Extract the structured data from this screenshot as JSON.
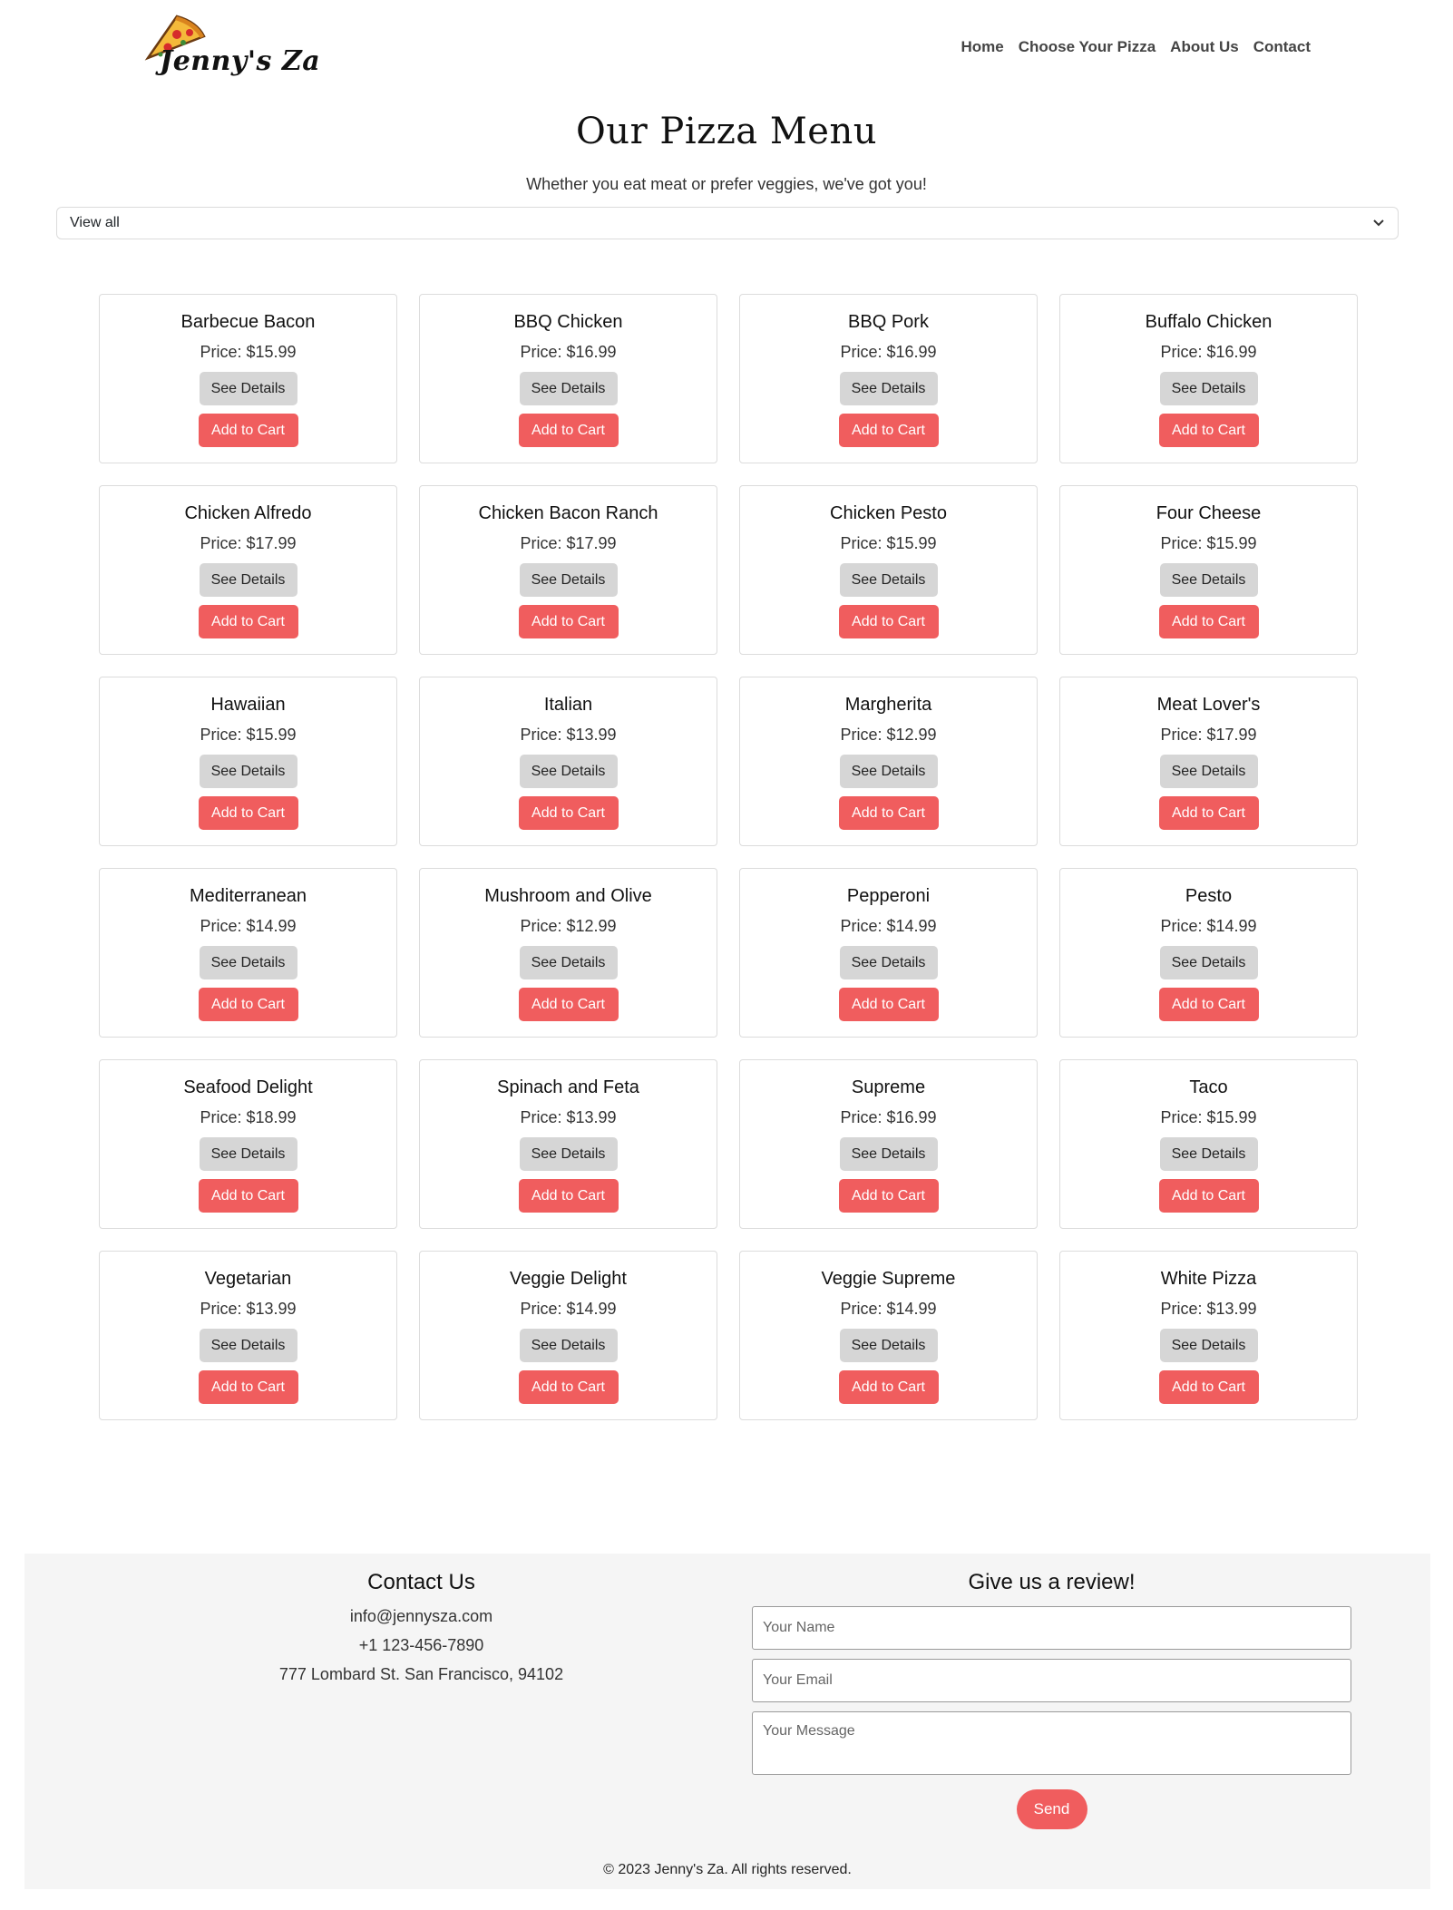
{
  "brand": {
    "name": "Jenny's Za"
  },
  "nav": {
    "items": [
      "Home",
      "Choose Your Pizza",
      "About Us",
      "Contact"
    ]
  },
  "page": {
    "title": "Our Pizza Menu",
    "subtitle": "Whether you eat meat or prefer veggies, we've got you!",
    "filter_value": "View all"
  },
  "buttons": {
    "details": "See Details",
    "cart": "Add to Cart"
  },
  "pizzas": [
    {
      "name": "Barbecue Bacon",
      "price": "Price: $15.99"
    },
    {
      "name": "BBQ Chicken",
      "price": "Price: $16.99"
    },
    {
      "name": "BBQ Pork",
      "price": "Price: $16.99"
    },
    {
      "name": "Buffalo Chicken",
      "price": "Price: $16.99"
    },
    {
      "name": "Chicken Alfredo",
      "price": "Price: $17.99"
    },
    {
      "name": "Chicken Bacon Ranch",
      "price": "Price: $17.99"
    },
    {
      "name": "Chicken Pesto",
      "price": "Price: $15.99"
    },
    {
      "name": "Four Cheese",
      "price": "Price: $15.99"
    },
    {
      "name": "Hawaiian",
      "price": "Price: $15.99"
    },
    {
      "name": "Italian",
      "price": "Price: $13.99"
    },
    {
      "name": "Margherita",
      "price": "Price: $12.99"
    },
    {
      "name": "Meat Lover's",
      "price": "Price: $17.99"
    },
    {
      "name": "Mediterranean",
      "price": "Price: $14.99"
    },
    {
      "name": "Mushroom and Olive",
      "price": "Price: $12.99"
    },
    {
      "name": "Pepperoni",
      "price": "Price: $14.99"
    },
    {
      "name": "Pesto",
      "price": "Price: $14.99"
    },
    {
      "name": "Seafood Delight",
      "price": "Price: $18.99"
    },
    {
      "name": "Spinach and Feta",
      "price": "Price: $13.99"
    },
    {
      "name": "Supreme",
      "price": "Price: $16.99"
    },
    {
      "name": "Taco",
      "price": "Price: $15.99"
    },
    {
      "name": "Vegetarian",
      "price": "Price: $13.99"
    },
    {
      "name": "Veggie Delight",
      "price": "Price: $14.99"
    },
    {
      "name": "Veggie Supreme",
      "price": "Price: $14.99"
    },
    {
      "name": "White Pizza",
      "price": "Price: $13.99"
    }
  ],
  "footer": {
    "contact_title": "Contact Us",
    "email": "info@jennysza.com",
    "phone": "+1 123-456-7890",
    "address": "777 Lombard St. San Francisco, 94102",
    "review_title": "Give us a review!",
    "name_placeholder": "Your Name",
    "email_placeholder": "Your Email",
    "message_placeholder": "Your Message",
    "send_label": "Send",
    "copyright": "© 2023 Jenny's Za. All rights reserved."
  },
  "colors": {
    "accent": "#f05d5e",
    "details_button": "#d6d6d6",
    "footer_bg": "#f5f5f5"
  },
  "icons": {
    "logo": "pizza-slice-icon",
    "select": "chevron-down-icon"
  }
}
